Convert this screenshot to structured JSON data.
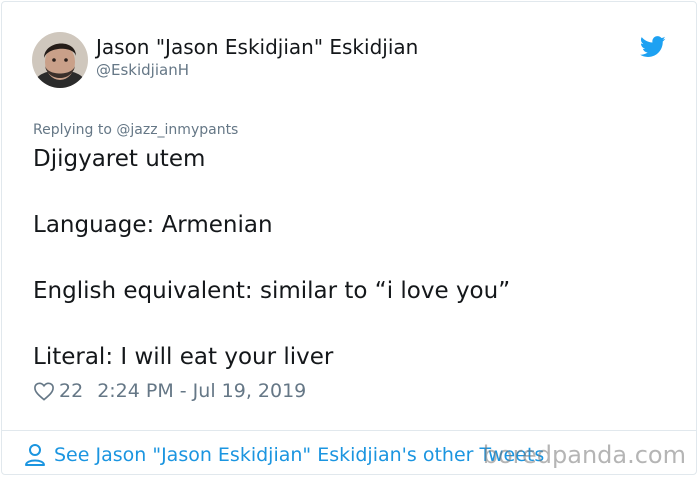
{
  "tweet": {
    "display_name": "Jason \"Jason Eskidjian\" Eskidjian",
    "handle": "@EskidjianH",
    "reply_to": "Replying to @jazz_inmypants",
    "lines": [
      "Djigyaret utem",
      "Language: Armenian",
      "English equivalent: similar to “i love you”",
      "Literal: I will eat your liver"
    ],
    "likes": "22",
    "timestamp": "2:24 PM - Jul 19, 2019",
    "footer_link": "See Jason \"Jason Eskidjian\" Eskidjian's other Tweets"
  },
  "icons": {
    "brand": "twitter-bird-icon",
    "like": "heart-icon",
    "profile": "person-icon"
  },
  "colors": {
    "twitter_blue": "#1da1f2",
    "link_blue": "#1b95e0",
    "muted_text": "#657786",
    "main_text": "#14171a"
  },
  "watermark": "boredpanda.com"
}
